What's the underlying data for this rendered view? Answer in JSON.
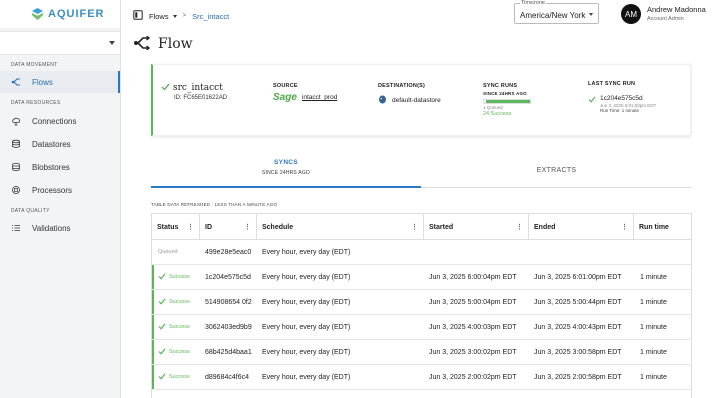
{
  "app": {
    "brand": "AQUIFER"
  },
  "sidebar": {
    "sections": [
      {
        "label": "DATA MOVEMENT"
      },
      {
        "label": "DATA RESOURCES"
      },
      {
        "label": "DATA QUALITY"
      }
    ],
    "items": [
      {
        "label": "Flows",
        "icon": "flow-icon"
      },
      {
        "label": "Connections",
        "icon": "cloud-icon"
      },
      {
        "label": "Datastores",
        "icon": "database-icon"
      },
      {
        "label": "Blobstores",
        "icon": "blob-icon"
      },
      {
        "label": "Processors",
        "icon": "chip-icon"
      },
      {
        "label": "Validations",
        "icon": "list-check-icon"
      }
    ]
  },
  "breadcrumb": {
    "root": "Flows",
    "current": "Src_intacct"
  },
  "timezone": {
    "label": "Timezone",
    "value": "America/New York"
  },
  "user": {
    "initials": "AM",
    "name": "Andrew Madonna",
    "role": "Account Admin"
  },
  "page": {
    "title": "Flow"
  },
  "summary": {
    "name": "src_intacct",
    "id": "ID: FC65E01622AD",
    "source_header": "SOURCE",
    "source_logo": "Sage",
    "source_name": "intacct_prod",
    "dest_header": "DESTINATION(S)",
    "dest_name": "default-datastore",
    "runs_header": "SYNC RUNS",
    "runs_sub": "SINCE 24HRS AGO",
    "runs_queued": "1 Queued",
    "runs_success": "24 Success",
    "runs_success_fraction": 0.96,
    "last_header": "LAST SYNC RUN",
    "last_id": "1c204e575c5d",
    "last_time": "Jun 3, 2025 6:01:00pm EDT",
    "last_runtime": "Run Time: 1 minute",
    "success_color": "#5db55b"
  },
  "tabs": {
    "syncs": "SYNCS",
    "syncs_sub": "SINCE 24HRS AGO",
    "extracts": "EXTRACTS"
  },
  "refreshed": "TABLE DATA REFRESHED : LESS THAN A MINUTE AGO",
  "table": {
    "headers": [
      "Status",
      "ID",
      "Schedule",
      "Started",
      "Ended",
      "Run time"
    ],
    "rows": [
      {
        "status": "Queued",
        "id": "499e28e5eac0",
        "schedule": "Every hour, every day (EDT)",
        "started": "",
        "ended": "",
        "runtime": ""
      },
      {
        "status": "Success",
        "id": "1c204e575c5d",
        "schedule": "Every hour, every day (EDT)",
        "started": "Jun 3, 2025 6:00:04pm EDT",
        "ended": "Jun 3, 2025 6:01:00pm EDT",
        "runtime": "1 minute"
      },
      {
        "status": "Success",
        "id": "514908654 0f2",
        "schedule": "Every hour, every day (EDT)",
        "started": "Jun 3, 2025 5:00:04pm EDT",
        "ended": "Jun 3, 2025 5:00:44pm EDT",
        "runtime": "1 minute"
      },
      {
        "status": "Success",
        "id": "3062403ed9b9",
        "schedule": "Every hour, every day (EDT)",
        "started": "Jun 3, 2025 4:00:03pm EDT",
        "ended": "Jun 3, 2025 4:00:43pm EDT",
        "runtime": "1 minute"
      },
      {
        "status": "Success",
        "id": "68b425d4baa1",
        "schedule": "Every hour, every day (EDT)",
        "started": "Jun 3, 2025 3:00:02pm EDT",
        "ended": "Jun 3, 2025 3:00:58pm EDT",
        "runtime": "1 minute"
      },
      {
        "status": "Success",
        "id": "d89684c4f6c4",
        "schedule": "Every hour, every day (EDT)",
        "started": "Jun 3, 2025 2:00:02pm EDT",
        "ended": "Jun 3, 2025 2:00:58pm EDT",
        "runtime": "1 minute"
      }
    ]
  }
}
